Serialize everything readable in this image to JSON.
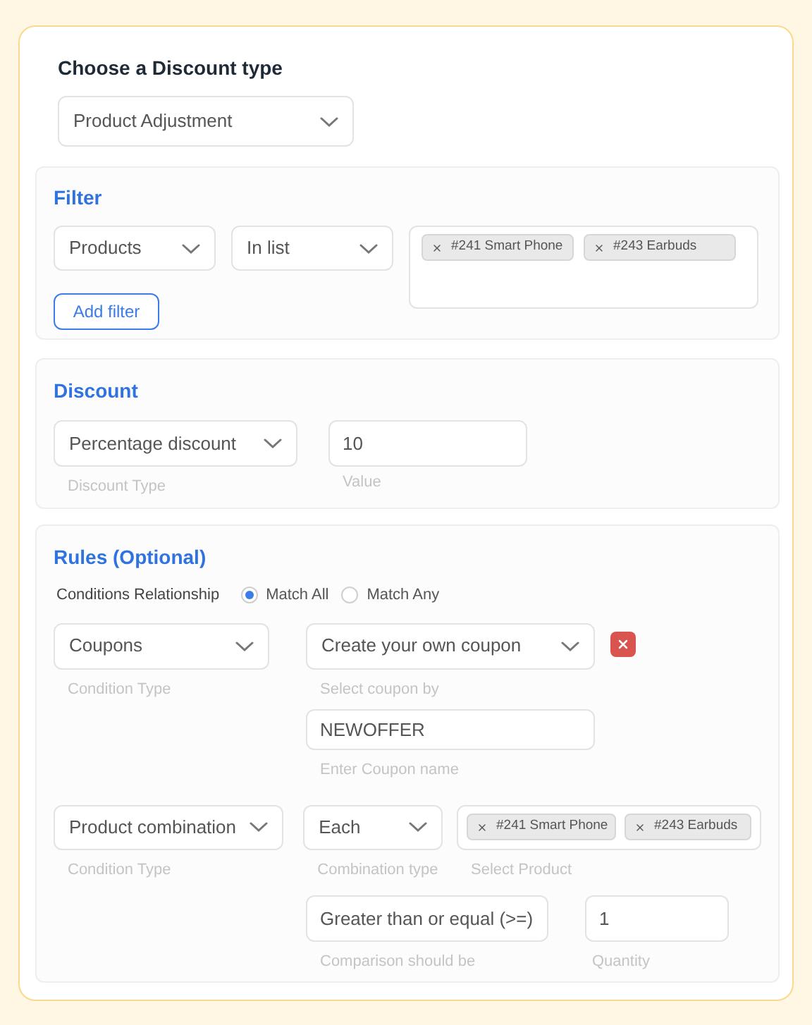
{
  "heading": "Choose a Discount type",
  "discount_type_select": {
    "value": "Product Adjustment"
  },
  "filter": {
    "title": "Filter",
    "field_select": {
      "value": "Products"
    },
    "operator_select": {
      "value": "In list"
    },
    "products": [
      {
        "label": "#241 Smart Phone"
      },
      {
        "label": "#243 Earbuds"
      }
    ],
    "add_button": "Add filter"
  },
  "discount": {
    "title": "Discount",
    "type_select": {
      "value": "Percentage discount",
      "caption": "Discount Type"
    },
    "value_field": {
      "value": "10",
      "caption": "Value"
    }
  },
  "rules": {
    "title": "Rules (Optional)",
    "relationship_label": "Conditions Relationship",
    "relationship_options": [
      {
        "label": "Match All",
        "selected": true
      },
      {
        "label": "Match Any",
        "selected": false
      }
    ],
    "conditions": [
      {
        "kind": "coupon",
        "condition_type": {
          "value": "Coupons",
          "caption": "Condition Type"
        },
        "coupon_by": {
          "value": "Create your own coupon",
          "caption": "Select coupon by"
        },
        "coupon_name": {
          "value": "NEWOFFER",
          "caption": "Enter Coupon name"
        }
      },
      {
        "kind": "product_combination",
        "condition_type": {
          "value": "Product combination",
          "caption": "Condition Type"
        },
        "combination_type": {
          "value": "Each",
          "caption": "Combination type"
        },
        "products": {
          "caption": "Select Product",
          "items": [
            {
              "label": "#241 Smart Phone"
            },
            {
              "label": "#243 Earbuds"
            }
          ]
        },
        "comparison": {
          "value": "Greater than or equal (>=)",
          "caption": "Comparison should be"
        },
        "quantity": {
          "value": "1",
          "caption": "Quantity"
        }
      }
    ]
  }
}
